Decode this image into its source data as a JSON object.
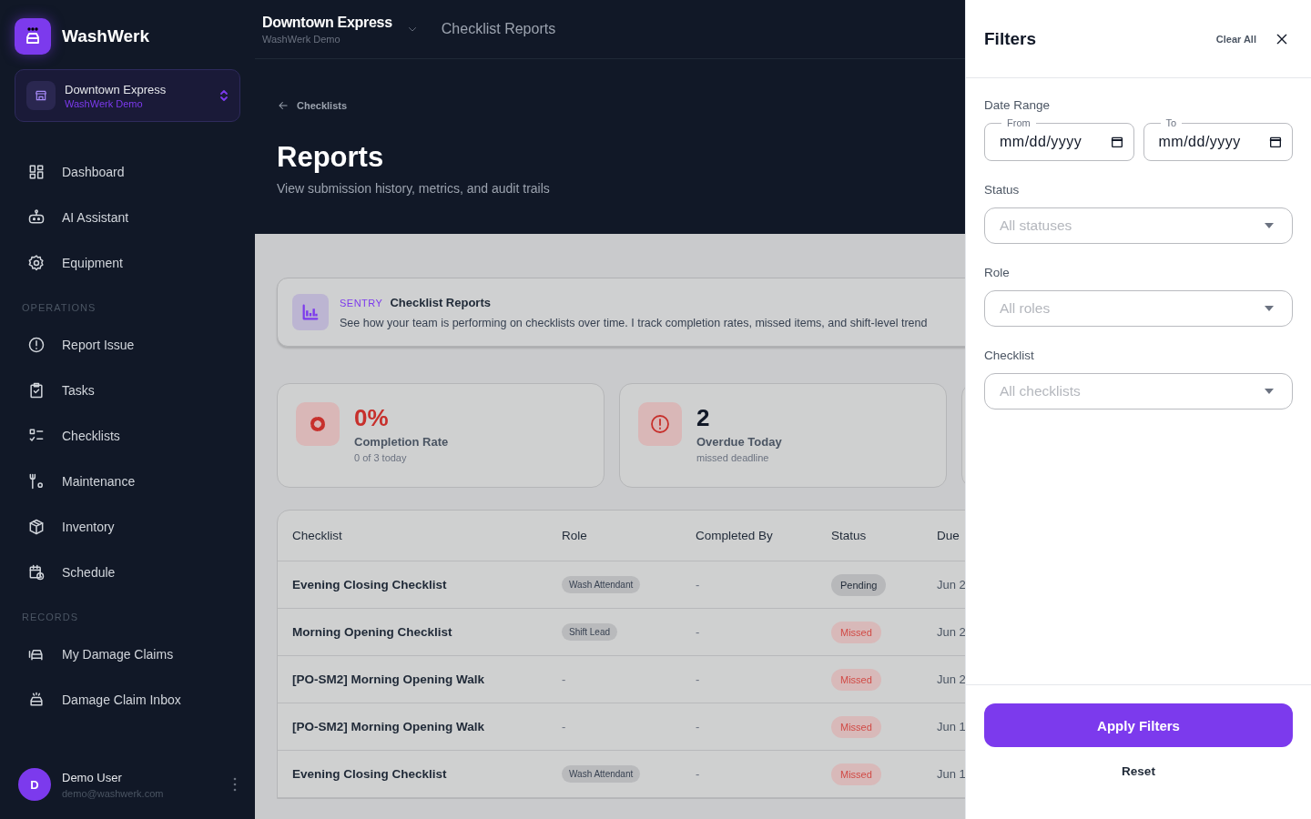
{
  "sidebar": {
    "brand": "WashWerk",
    "location": {
      "name": "Downtown Express",
      "org": "WashWerk Demo"
    },
    "sections": [
      {
        "items": [
          {
            "label": "Dashboard"
          },
          {
            "label": "AI Assistant"
          },
          {
            "label": "Equipment"
          }
        ]
      },
      {
        "heading": "OPERATIONS",
        "items": [
          {
            "label": "Report Issue"
          },
          {
            "label": "Tasks"
          },
          {
            "label": "Checklists"
          },
          {
            "label": "Maintenance"
          },
          {
            "label": "Inventory"
          },
          {
            "label": "Schedule"
          }
        ]
      },
      {
        "heading": "RECORDS",
        "items": [
          {
            "label": "My Damage Claims"
          },
          {
            "label": "Damage Claim Inbox"
          }
        ]
      }
    ],
    "user": {
      "initial": "D",
      "name": "Demo User",
      "email": "demo@washwerk.com"
    }
  },
  "topbar": {
    "location": "Downtown Express",
    "org": "WashWerk Demo",
    "page": "Checklist Reports"
  },
  "header": {
    "back": "Checklists",
    "title": "Reports",
    "subtitle": "View submission history, metrics, and audit trails"
  },
  "sentry": {
    "tag": "SENTRY",
    "title": "Checklist Reports",
    "text": "See how your team is performing on checklists over time. I track completion rates, missed items, and shift-level trend"
  },
  "stats": [
    {
      "value": "0%",
      "label": "Completion Rate",
      "note": "0 of 3 today",
      "kind": "danger"
    },
    {
      "value": "2",
      "label": "Overdue Today",
      "note": "missed deadline",
      "kind": "default"
    }
  ],
  "table": {
    "columns": [
      "Checklist",
      "Role",
      "Completed By",
      "Status",
      "Due"
    ],
    "rows": [
      {
        "checklist": "Evening Closing Checklist",
        "role": "Wash Attendant",
        "completed_by": "-",
        "status": {
          "label": "Pending",
          "kind": "pending"
        },
        "due": "Jun 2"
      },
      {
        "checklist": "Morning Opening Checklist",
        "role": "Shift Lead",
        "completed_by": "-",
        "status": {
          "label": "Missed",
          "kind": "missed"
        },
        "due": "Jun 2"
      },
      {
        "checklist": "[PO-SM2] Morning Opening Walk",
        "role": "-",
        "completed_by": "-",
        "status": {
          "label": "Missed",
          "kind": "missed"
        },
        "due": "Jun 2"
      },
      {
        "checklist": "[PO-SM2] Morning Opening Walk",
        "role": "-",
        "completed_by": "-",
        "status": {
          "label": "Missed",
          "kind": "missed"
        },
        "due": "Jun 1"
      },
      {
        "checklist": "Evening Closing Checklist",
        "role": "Wash Attendant",
        "completed_by": "-",
        "status": {
          "label": "Missed",
          "kind": "missed"
        },
        "due": "Jun 1"
      }
    ]
  },
  "filters": {
    "title": "Filters",
    "clear": "Clear All",
    "date_range": {
      "label": "Date Range",
      "from": {
        "legend": "From",
        "value": "mm/dd/yyyy"
      },
      "to": {
        "legend": "To",
        "value": "mm/dd/yyyy"
      }
    },
    "selects": [
      {
        "label": "Status",
        "placeholder": "All statuses"
      },
      {
        "label": "Role",
        "placeholder": "All roles"
      },
      {
        "label": "Checklist",
        "placeholder": "All checklists"
      }
    ],
    "apply": "Apply Filters",
    "reset": "Reset"
  }
}
